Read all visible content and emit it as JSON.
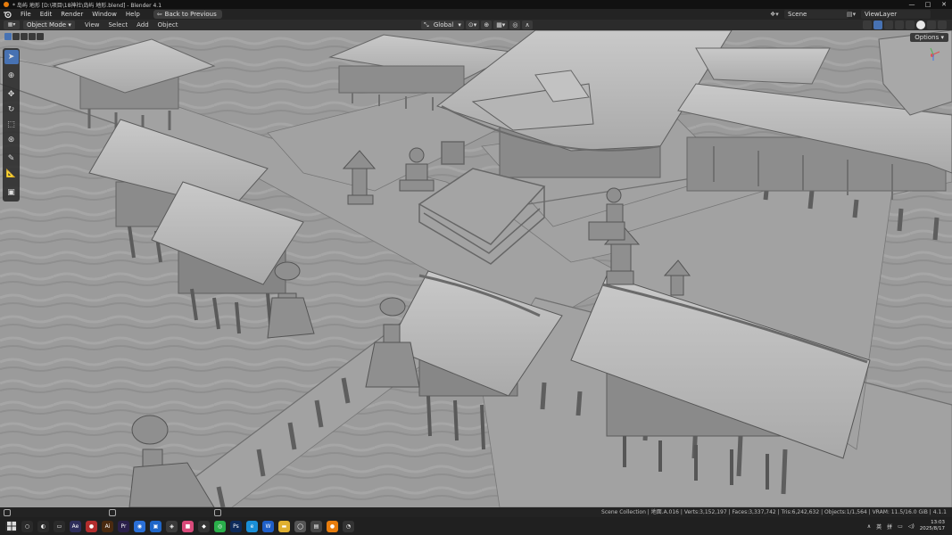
{
  "window": {
    "title": "* 岛屿 地形 [D:\\项目\\18神社\\岛屿 地形.blend] - Blender 4.1",
    "controls": [
      "—",
      "□",
      "✕"
    ]
  },
  "menubar": {
    "items": [
      "File",
      "Edit",
      "Render",
      "Window",
      "Help"
    ],
    "back_label": "Back to Previous",
    "scene": "Scene",
    "view_layer": "ViewLayer"
  },
  "header3d": {
    "mode": "Object Mode",
    "menus": [
      "View",
      "Select",
      "Add",
      "Object"
    ],
    "transform_orientation": "Global",
    "options_label": "Options"
  },
  "toolbar": {
    "tools": [
      "select-box",
      "cursor",
      "move",
      "rotate",
      "scale",
      "transform",
      "annotate",
      "measure",
      "add-cube"
    ],
    "active": "select-box"
  },
  "statusbar": {
    "stats": "Scene Collection | 地面.A.016 | Verts:3,152,197 | Faces:3,337,742 | Tris:6,242,632 | Objects:1/1,564 | VRAM: 11.5/16.0 GiB | 4.1.1"
  },
  "taskbar": {
    "ime_label": "英",
    "ime2": "拼",
    "time": "13:03",
    "date": "2025/8/17"
  },
  "colors": {
    "viewport_bg": "#9a9a9a",
    "accent": "#4772b3",
    "blender_orange": "#e87d0d"
  }
}
